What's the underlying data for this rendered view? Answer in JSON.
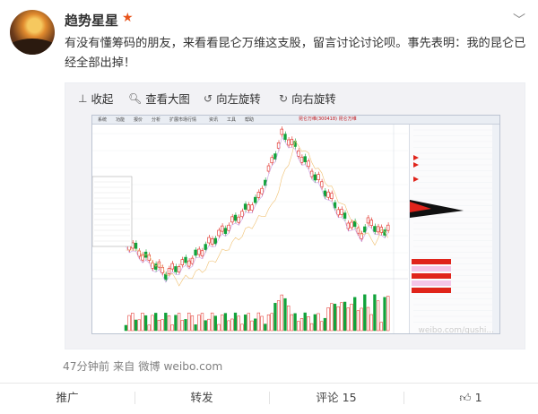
{
  "user": {
    "name": "趋势星星",
    "vip_icon": "star-icon"
  },
  "post": {
    "text": "有没有懂筹码的朋友，来看看昆仑万维这支股，留言讨论讨论呗。事先表明：我的昆仑已经全部出掉！",
    "time": "47分钟前",
    "source_prefix": "来自",
    "source": "微博 weibo.com"
  },
  "toolbar": {
    "collapse": "收起",
    "zoom": "查看大图",
    "rotate_left": "向左旋转",
    "rotate_right": "向右旋转"
  },
  "screenshot": {
    "banner": "昆仑万维(300418)   昆仑万维",
    "menu": [
      "系统",
      "功能",
      "报价",
      "分析",
      "扩展市场行情",
      "资讯",
      "工具",
      "帮助"
    ]
  },
  "watermark": "weibo.com/qushi...",
  "actions": {
    "promote": "推广",
    "repost": "转发",
    "comment": "评论 15",
    "like": "1"
  },
  "colors": {
    "up": "#e0241b",
    "down": "#11a33b",
    "accent": "#e8541c"
  }
}
